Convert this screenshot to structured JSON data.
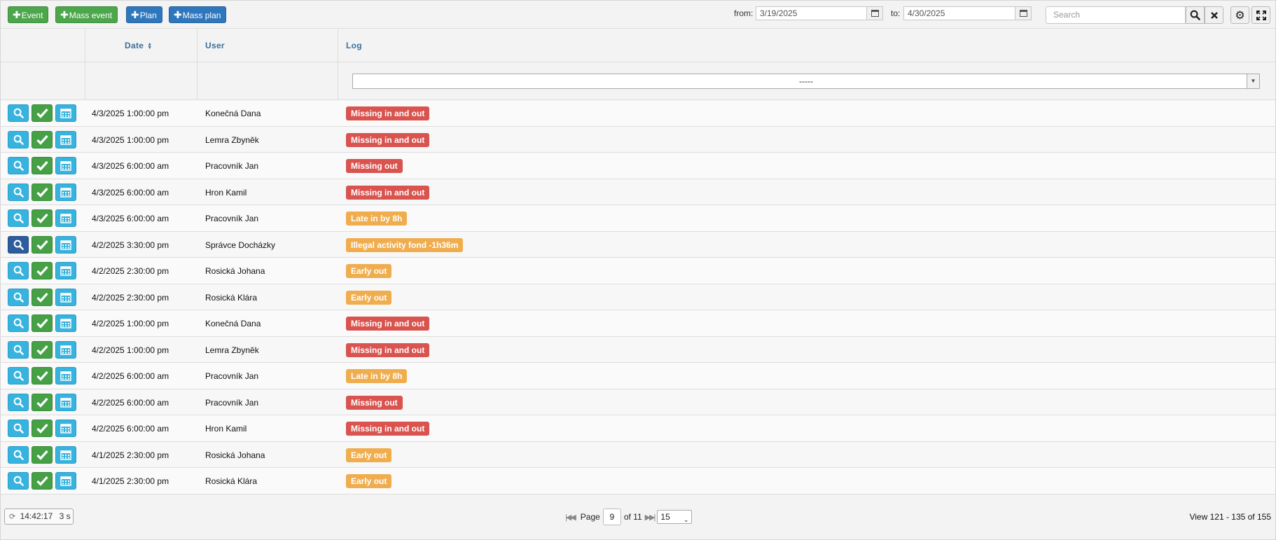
{
  "toolbar": {
    "event_label": "Event",
    "mass_event_label": "Mass event",
    "plan_label": "Plan",
    "mass_plan_label": "Mass plan",
    "from_label": "from:",
    "from_value": "3/19/2025",
    "to_label": "to:",
    "to_value": "4/30/2025",
    "search_placeholder": "Search"
  },
  "header": {
    "date": "Date",
    "user": "User",
    "log": "Log"
  },
  "filter": {
    "log_value": "-----"
  },
  "rows": [
    {
      "date": "4/3/2025 1:00:00 pm",
      "user": "Konečná Dana",
      "log": "Missing in and out",
      "status": "red"
    },
    {
      "date": "4/3/2025 1:00:00 pm",
      "user": "Lemra Zbyněk",
      "log": "Missing in and out",
      "status": "red"
    },
    {
      "date": "4/3/2025 6:00:00 am",
      "user": "Pracovník Jan",
      "log": "Missing out",
      "status": "red"
    },
    {
      "date": "4/3/2025 6:00:00 am",
      "user": "Hron Kamil",
      "log": "Missing in and out",
      "status": "red"
    },
    {
      "date": "4/3/2025 6:00:00 am",
      "user": "Pracovník Jan",
      "log": "Late in by 8h",
      "status": "orange"
    },
    {
      "date": "4/2/2025 3:30:00 pm",
      "user": "Správce Docházky",
      "log": "Illegal activity fond -1h36m",
      "status": "orange",
      "active": true
    },
    {
      "date": "4/2/2025 2:30:00 pm",
      "user": "Rosická Johana",
      "log": "Early out",
      "status": "orange"
    },
    {
      "date": "4/2/2025 2:30:00 pm",
      "user": "Rosická Klára",
      "log": "Early out",
      "status": "orange"
    },
    {
      "date": "4/2/2025 1:00:00 pm",
      "user": "Konečná Dana",
      "log": "Missing in and out",
      "status": "red"
    },
    {
      "date": "4/2/2025 1:00:00 pm",
      "user": "Lemra Zbyněk",
      "log": "Missing in and out",
      "status": "red"
    },
    {
      "date": "4/2/2025 6:00:00 am",
      "user": "Pracovník Jan",
      "log": "Late in by 8h",
      "status": "orange"
    },
    {
      "date": "4/2/2025 6:00:00 am",
      "user": "Pracovník Jan",
      "log": "Missing out",
      "status": "red"
    },
    {
      "date": "4/2/2025 6:00:00 am",
      "user": "Hron Kamil",
      "log": "Missing in and out",
      "status": "red"
    },
    {
      "date": "4/1/2025 2:30:00 pm",
      "user": "Rosická Johana",
      "log": "Early out",
      "status": "orange"
    },
    {
      "date": "4/1/2025 2:30:00 pm",
      "user": "Rosická Klára",
      "log": "Early out",
      "status": "orange"
    }
  ],
  "footer": {
    "timer_time": "14:42:17",
    "timer_interval": "3 s",
    "page_label": "Page",
    "page_value": "9",
    "of_label": "of 11",
    "page_size": "15",
    "view_info": "View 121 - 135 of 155"
  },
  "colors": {
    "red": "#d9534f",
    "orange": "#f0ad4e",
    "green": "#4ca64c",
    "blue": "#2f77bd",
    "info": "#36b3de"
  }
}
